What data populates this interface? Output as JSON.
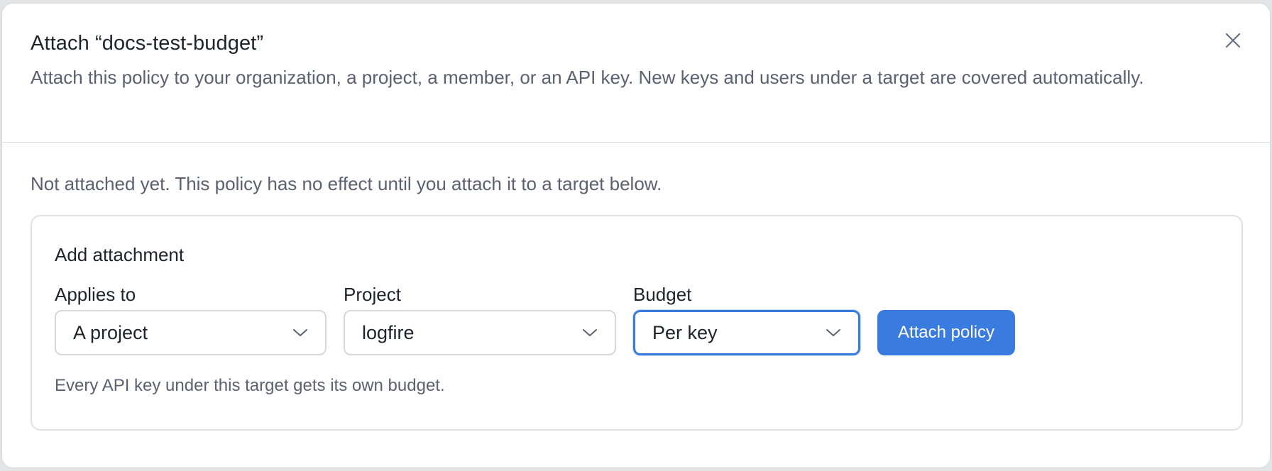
{
  "dialog": {
    "title": "Attach “docs-test-budget”",
    "description": "Attach this policy to your organization, a project, a member, or an API key. New keys and users under a target are covered automatically.",
    "close_icon": "close-icon"
  },
  "status": {
    "text": "Not attached yet. This policy has no effect until you attach it to a target below."
  },
  "attachment": {
    "title": "Add attachment",
    "applies_to": {
      "label": "Applies to",
      "value": "A project"
    },
    "project": {
      "label": "Project",
      "value": "logfire"
    },
    "budget": {
      "label": "Budget",
      "value": "Per key"
    },
    "submit_label": "Attach policy",
    "hint": "Every API key under this target gets its own budget."
  },
  "colors": {
    "accent": "#3a7be0",
    "muted_text": "#5b6170",
    "primary_text": "#1f232b"
  },
  "icons": {
    "dropdown": "chevron-down-icon"
  }
}
